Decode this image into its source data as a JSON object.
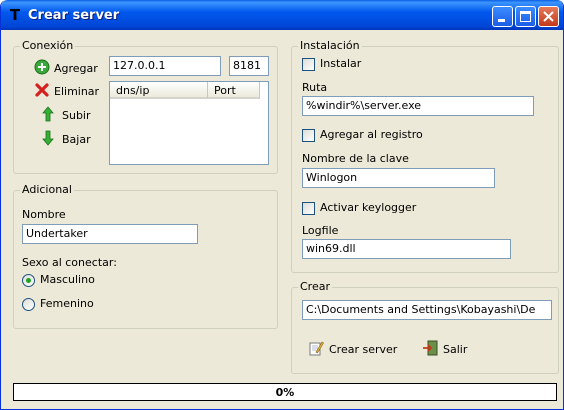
{
  "window": {
    "title": "Crear server"
  },
  "conexion": {
    "legend": "Conexión",
    "agregar_label": "Agregar",
    "eliminar_label": "Eliminar",
    "subir_label": "Subir",
    "bajar_label": "Bajar",
    "host_value": "127.0.0.1",
    "port_value": "8181",
    "list_columns": [
      "dns/ip",
      "Port"
    ],
    "list_rows": []
  },
  "adicional": {
    "legend": "Adicional",
    "nombre_label": "Nombre",
    "nombre_value": "Undertaker",
    "sexo_label": "Sexo al conectar:",
    "masculino_label": "Masculino",
    "femenino_label": "Femenino",
    "selected": "Masculino"
  },
  "instalacion": {
    "legend": "Instalación",
    "instalar_label": "Instalar",
    "instalar_checked": false,
    "ruta_label": "Ruta",
    "ruta_value": "%windir%\\server.exe",
    "registro_label": "Agregar al registro",
    "registro_checked": false,
    "clave_label": "Nombre de la clave",
    "clave_value": "Winlogon",
    "keylogger_label": "Activar keylogger",
    "keylogger_checked": false,
    "logfile_label": "Logfile",
    "logfile_value": "win69.dll"
  },
  "crear": {
    "legend": "Crear",
    "path_value": "C:\\Documents and Settings\\Kobayashi\\De",
    "crear_server_label": "Crear server",
    "salir_label": "Salir"
  },
  "progress": {
    "value_percent": 0,
    "text": "0%"
  },
  "icons": {
    "add": "plus-circle-icon",
    "remove": "red-x-icon",
    "up": "green-up-arrow-icon",
    "down": "green-down-arrow-icon",
    "create": "notepad-pencil-icon",
    "exit": "exit-door-icon"
  },
  "colors": {
    "title_bar": "#0058ee",
    "window_bg": "#ece9d8",
    "group_border": "#d0d0bf",
    "close_button": "#c4381b"
  }
}
